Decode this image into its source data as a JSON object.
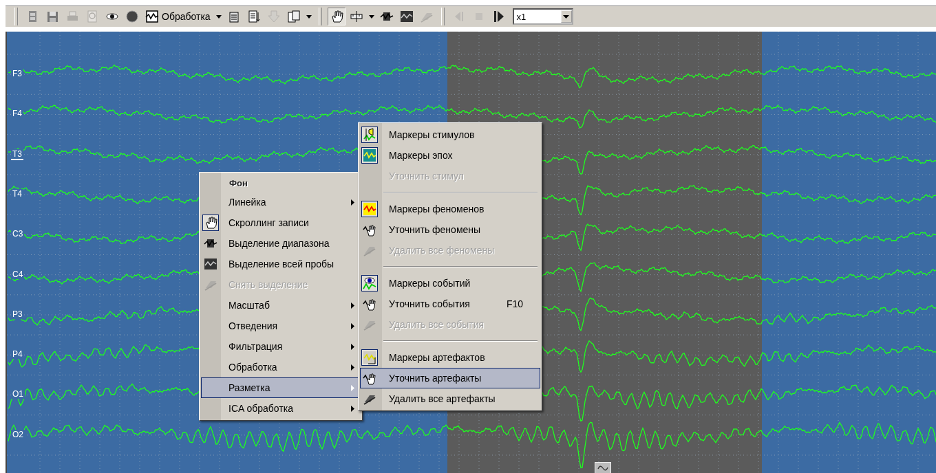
{
  "toolbar": [
    {
      "kind": "button",
      "disabled": false,
      "pressed": false
    },
    {
      "kind": "button",
      "disabled": false,
      "pressed": false
    },
    {
      "kind": "button",
      "disabled": true,
      "pressed": false
    },
    {
      "kind": "button",
      "disabled": true,
      "pressed": false
    },
    {
      "kind": "button",
      "disabled": false,
      "pressed": false
    },
    {
      "kind": "button",
      "disabled": false,
      "pressed": false
    },
    {
      "kind": "label-button",
      "label": "Обработка"
    },
    {
      "kind": "caret"
    },
    {
      "kind": "button",
      "disabled": false,
      "pressed": false
    },
    {
      "kind": "button",
      "disabled": false,
      "pressed": false
    },
    {
      "kind": "button",
      "disabled": true,
      "pressed": false
    },
    {
      "kind": "button",
      "disabled": false,
      "pressed": false
    },
    {
      "kind": "caret"
    },
    {
      "kind": "separator"
    },
    {
      "kind": "button",
      "disabled": false,
      "pressed": true
    },
    {
      "kind": "button",
      "disabled": false,
      "pressed": false
    },
    {
      "kind": "caret"
    },
    {
      "kind": "button",
      "disabled": false,
      "pressed": false
    },
    {
      "kind": "button",
      "disabled": false,
      "pressed": false
    },
    {
      "kind": "button",
      "disabled": true,
      "pressed": false
    },
    {
      "kind": "separator"
    },
    {
      "kind": "button",
      "disabled": true,
      "pressed": false
    },
    {
      "kind": "button",
      "disabled": true,
      "pressed": false
    },
    {
      "kind": "button",
      "disabled": false,
      "pressed": false
    },
    {
      "kind": "combo",
      "value": "x1"
    }
  ],
  "channels": [
    {
      "label": "F3",
      "selected": false
    },
    {
      "label": "F4",
      "selected": false
    },
    {
      "label": "T3",
      "selected": true
    },
    {
      "label": "T4",
      "selected": false
    },
    {
      "label": "C3",
      "selected": false
    },
    {
      "label": "C4",
      "selected": false
    },
    {
      "label": "P3",
      "selected": false
    },
    {
      "label": "P4",
      "selected": false
    },
    {
      "label": "O1",
      "selected": false
    },
    {
      "label": "O2",
      "selected": false
    }
  ],
  "context_menu": [
    {
      "kind": "header",
      "label": "Фон"
    },
    {
      "kind": "item",
      "label": "Линейка",
      "submenu": true,
      "checked": false,
      "disabled": false,
      "selected": false
    },
    {
      "kind": "item",
      "label": "Скроллинг записи",
      "submenu": false,
      "checked": true,
      "disabled": false,
      "selected": false
    },
    {
      "kind": "item",
      "label": "Выделение диапазона",
      "submenu": false,
      "checked": false,
      "disabled": false,
      "selected": false
    },
    {
      "kind": "item",
      "label": "Выделение всей пробы",
      "submenu": false,
      "checked": false,
      "disabled": false,
      "selected": false
    },
    {
      "kind": "item",
      "label": "Снять выделение",
      "submenu": false,
      "checked": false,
      "disabled": true,
      "selected": false
    },
    {
      "kind": "item",
      "label": "Масштаб",
      "submenu": true,
      "checked": false,
      "disabled": false,
      "selected": false
    },
    {
      "kind": "item",
      "label": "Отведения",
      "submenu": true,
      "checked": false,
      "disabled": false,
      "selected": false
    },
    {
      "kind": "item",
      "label": "Фильтрация",
      "submenu": true,
      "checked": false,
      "disabled": false,
      "selected": false
    },
    {
      "kind": "item",
      "label": "Обработка",
      "submenu": true,
      "checked": false,
      "disabled": false,
      "selected": false
    },
    {
      "kind": "item",
      "label": "Разметка",
      "submenu": true,
      "checked": false,
      "disabled": false,
      "selected": true
    },
    {
      "kind": "item",
      "label": "ICA обработка",
      "submenu": true,
      "checked": false,
      "disabled": false,
      "selected": false
    }
  ],
  "submenu": [
    {
      "kind": "item",
      "label": "Маркеры стимулов",
      "checked": true,
      "disabled": false,
      "selected": false
    },
    {
      "kind": "item",
      "label": "Маркеры эпох",
      "checked": true,
      "disabled": false,
      "selected": false
    },
    {
      "kind": "item",
      "label": "Уточнить стимул",
      "checked": false,
      "disabled": true,
      "selected": false
    },
    {
      "kind": "separator"
    },
    {
      "kind": "item",
      "label": "Маркеры феноменов",
      "checked": true,
      "disabled": false,
      "selected": false
    },
    {
      "kind": "item",
      "label": "Уточнить феномены",
      "checked": false,
      "disabled": false,
      "selected": false
    },
    {
      "kind": "item",
      "label": "Удалить все феномены",
      "checked": false,
      "disabled": true,
      "selected": false
    },
    {
      "kind": "separator"
    },
    {
      "kind": "item",
      "label": "Маркеры событий",
      "checked": true,
      "disabled": false,
      "selected": false
    },
    {
      "kind": "item",
      "label": "Уточнить события",
      "shortcut": "F10",
      "checked": false,
      "disabled": false,
      "selected": false
    },
    {
      "kind": "item",
      "label": "Удалить все события",
      "checked": false,
      "disabled": true,
      "selected": false
    },
    {
      "kind": "separator"
    },
    {
      "kind": "item",
      "label": "Маркеры артефактов",
      "checked": true,
      "disabled": false,
      "selected": false
    },
    {
      "kind": "item",
      "label": "Уточнить артефакты",
      "checked": false,
      "disabled": false,
      "selected": true
    },
    {
      "kind": "item",
      "label": "Удалить все артефакты",
      "checked": false,
      "disabled": false,
      "selected": false
    }
  ]
}
